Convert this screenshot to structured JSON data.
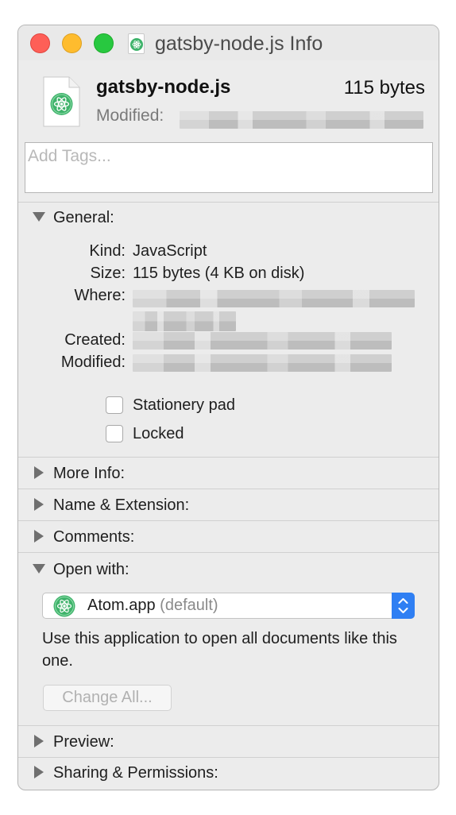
{
  "window": {
    "title": "gatsby-node.js Info"
  },
  "header": {
    "file_name": "gatsby-node.js",
    "file_size": "115 bytes",
    "modified_label": "Modified:"
  },
  "tags": {
    "placeholder": "Add Tags..."
  },
  "general": {
    "title": "General:",
    "rows": [
      {
        "label": "Kind:",
        "value": "JavaScript"
      },
      {
        "label": "Size:",
        "value": "115 bytes (4 KB on disk)"
      },
      {
        "label": "Where:",
        "value": ""
      },
      {
        "label": "Created:",
        "value": ""
      },
      {
        "label": "Modified:",
        "value": ""
      }
    ],
    "stationery_label": "Stationery pad",
    "locked_label": "Locked"
  },
  "sections": {
    "more_info": "More Info:",
    "name_extension": "Name & Extension:",
    "comments": "Comments:",
    "open_with": "Open with:",
    "preview": "Preview:",
    "sharing": "Sharing & Permissions:"
  },
  "open_with": {
    "app_name": "Atom.app",
    "default_suffix": "(default)",
    "description": "Use this application to open all documents like this one.",
    "change_all_label": "Change All..."
  },
  "icons": {
    "app_icon": "atom-icon",
    "accent": "#2f7ff3",
    "atom_green": "#3fb36b"
  }
}
